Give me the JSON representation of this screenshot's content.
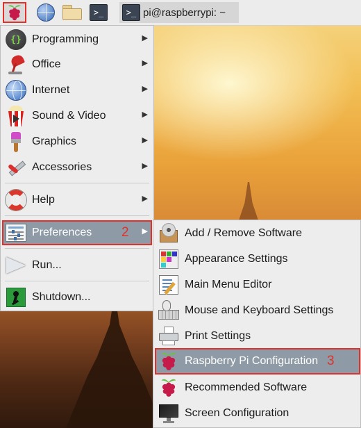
{
  "taskbar": {
    "menu_icon": "raspberry-icon",
    "launchers": [
      "globe-icon",
      "folder-icon",
      "terminal-icon"
    ],
    "task_label": "pi@raspberrypi: ~",
    "terminal_glyph": ">_"
  },
  "main_menu": {
    "items": [
      {
        "label": "Programming",
        "icon": "code-braces-icon",
        "has_submenu": true
      },
      {
        "label": "Office",
        "icon": "lamp-icon",
        "has_submenu": true
      },
      {
        "label": "Internet",
        "icon": "globe-icon",
        "has_submenu": true
      },
      {
        "label": "Sound & Video",
        "icon": "popcorn-icon",
        "has_submenu": true
      },
      {
        "label": "Graphics",
        "icon": "paintbrush-icon",
        "has_submenu": true
      },
      {
        "label": "Accessories",
        "icon": "knife-icon",
        "has_submenu": true
      },
      {
        "label": "Help",
        "icon": "lifebuoy-icon",
        "has_submenu": true
      },
      {
        "label": "Preferences",
        "icon": "preferences-icon",
        "has_submenu": true,
        "selected": true,
        "step": "2"
      },
      {
        "label": "Run...",
        "icon": "paper-plane-icon",
        "has_submenu": false
      },
      {
        "label": "Shutdown...",
        "icon": "exit-icon",
        "has_submenu": false
      }
    ],
    "programming_glyph": "{}"
  },
  "submenu": {
    "items": [
      {
        "label": "Add / Remove Software",
        "icon": "package-icon"
      },
      {
        "label": "Appearance Settings",
        "icon": "palette-icon"
      },
      {
        "label": "Main Menu Editor",
        "icon": "menu-editor-icon"
      },
      {
        "label": "Mouse and Keyboard Settings",
        "icon": "mouse-keyboard-icon"
      },
      {
        "label": "Print Settings",
        "icon": "printer-icon"
      },
      {
        "label": "Raspberry Pi Configuration",
        "icon": "raspberry-icon",
        "selected": true,
        "step": "3"
      },
      {
        "label": "Recommended Software",
        "icon": "raspberry-icon"
      },
      {
        "label": "Screen Configuration",
        "icon": "monitor-icon"
      }
    ]
  },
  "arrow_glyph": "▶",
  "colors": {
    "highlight": "#e0322b",
    "selected_bg": "#8e9aa5",
    "menu_bg": "#ededed",
    "raspberry_red": "#c51a4a",
    "leaf_green": "#6cc04a"
  }
}
